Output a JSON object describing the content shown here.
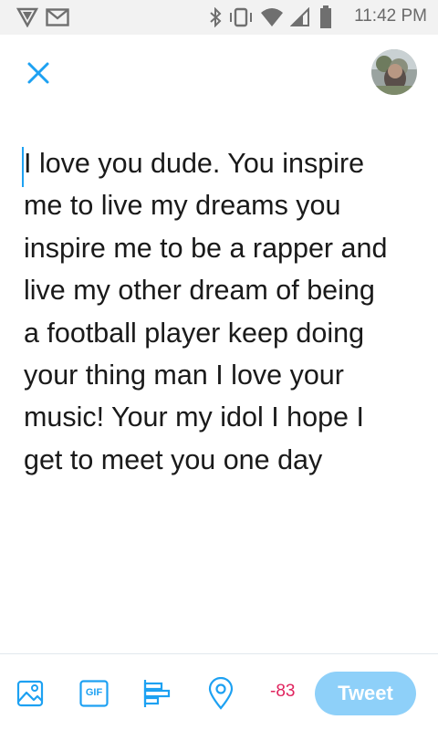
{
  "status_bar": {
    "time": "11:42 PM",
    "icons": [
      "vpn-shield-icon",
      "gmail-icon",
      "bluetooth-icon",
      "vibrate-icon",
      "wifi-icon",
      "signal-icon",
      "battery-icon"
    ]
  },
  "header": {
    "close_icon": "close-icon",
    "avatar": "user-avatar"
  },
  "composer": {
    "text": "I love you dude. You inspire\nme to live my dreams you\ninspire me to be a rapper and\nlive my other dream of being\na football player keep doing\nyour thing man I love your\nmusic! Your my idol I hope I\nget to meet you one day"
  },
  "toolbar": {
    "icons": [
      "image-icon",
      "gif-icon",
      "poll-icon",
      "location-icon"
    ],
    "gif_label": "GIF",
    "char_count": "-83",
    "tweet_label": "Tweet"
  },
  "colors": {
    "accent": "#1da1f2",
    "tweet_button_disabled": "#8ed0f9",
    "over_limit": "#e0245e",
    "status_bar_bg": "#f2f2f2"
  }
}
